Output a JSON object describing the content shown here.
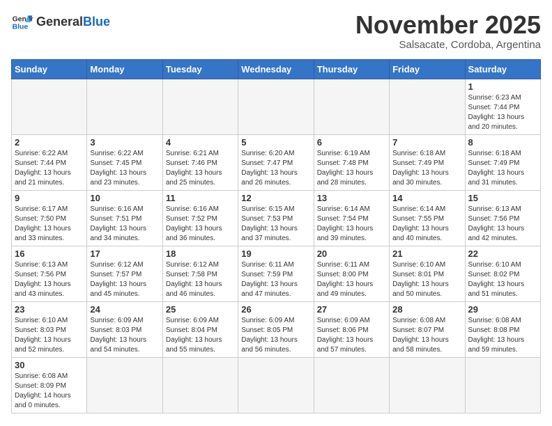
{
  "header": {
    "logo_general": "General",
    "logo_blue": "Blue",
    "month_title": "November 2025",
    "subtitle": "Salsacate, Cordoba, Argentina"
  },
  "weekdays": [
    "Sunday",
    "Monday",
    "Tuesday",
    "Wednesday",
    "Thursday",
    "Friday",
    "Saturday"
  ],
  "weeks": [
    [
      {
        "day": "",
        "info": ""
      },
      {
        "day": "",
        "info": ""
      },
      {
        "day": "",
        "info": ""
      },
      {
        "day": "",
        "info": ""
      },
      {
        "day": "",
        "info": ""
      },
      {
        "day": "",
        "info": ""
      },
      {
        "day": "1",
        "info": "Sunrise: 6:23 AM\nSunset: 7:44 PM\nDaylight: 13 hours and 20 minutes."
      }
    ],
    [
      {
        "day": "2",
        "info": "Sunrise: 6:22 AM\nSunset: 7:44 PM\nDaylight: 13 hours and 21 minutes."
      },
      {
        "day": "3",
        "info": "Sunrise: 6:22 AM\nSunset: 7:45 PM\nDaylight: 13 hours and 23 minutes."
      },
      {
        "day": "4",
        "info": "Sunrise: 6:21 AM\nSunset: 7:46 PM\nDaylight: 13 hours and 25 minutes."
      },
      {
        "day": "5",
        "info": "Sunrise: 6:20 AM\nSunset: 7:47 PM\nDaylight: 13 hours and 26 minutes."
      },
      {
        "day": "6",
        "info": "Sunrise: 6:19 AM\nSunset: 7:48 PM\nDaylight: 13 hours and 28 minutes."
      },
      {
        "day": "7",
        "info": "Sunrise: 6:18 AM\nSunset: 7:49 PM\nDaylight: 13 hours and 30 minutes."
      },
      {
        "day": "8",
        "info": "Sunrise: 6:18 AM\nSunset: 7:49 PM\nDaylight: 13 hours and 31 minutes."
      }
    ],
    [
      {
        "day": "9",
        "info": "Sunrise: 6:17 AM\nSunset: 7:50 PM\nDaylight: 13 hours and 33 minutes."
      },
      {
        "day": "10",
        "info": "Sunrise: 6:16 AM\nSunset: 7:51 PM\nDaylight: 13 hours and 34 minutes."
      },
      {
        "day": "11",
        "info": "Sunrise: 6:16 AM\nSunset: 7:52 PM\nDaylight: 13 hours and 36 minutes."
      },
      {
        "day": "12",
        "info": "Sunrise: 6:15 AM\nSunset: 7:53 PM\nDaylight: 13 hours and 37 minutes."
      },
      {
        "day": "13",
        "info": "Sunrise: 6:14 AM\nSunset: 7:54 PM\nDaylight: 13 hours and 39 minutes."
      },
      {
        "day": "14",
        "info": "Sunrise: 6:14 AM\nSunset: 7:55 PM\nDaylight: 13 hours and 40 minutes."
      },
      {
        "day": "15",
        "info": "Sunrise: 6:13 AM\nSunset: 7:56 PM\nDaylight: 13 hours and 42 minutes."
      }
    ],
    [
      {
        "day": "16",
        "info": "Sunrise: 6:13 AM\nSunset: 7:56 PM\nDaylight: 13 hours and 43 minutes."
      },
      {
        "day": "17",
        "info": "Sunrise: 6:12 AM\nSunset: 7:57 PM\nDaylight: 13 hours and 45 minutes."
      },
      {
        "day": "18",
        "info": "Sunrise: 6:12 AM\nSunset: 7:58 PM\nDaylight: 13 hours and 46 minutes."
      },
      {
        "day": "19",
        "info": "Sunrise: 6:11 AM\nSunset: 7:59 PM\nDaylight: 13 hours and 47 minutes."
      },
      {
        "day": "20",
        "info": "Sunrise: 6:11 AM\nSunset: 8:00 PM\nDaylight: 13 hours and 49 minutes."
      },
      {
        "day": "21",
        "info": "Sunrise: 6:10 AM\nSunset: 8:01 PM\nDaylight: 13 hours and 50 minutes."
      },
      {
        "day": "22",
        "info": "Sunrise: 6:10 AM\nSunset: 8:02 PM\nDaylight: 13 hours and 51 minutes."
      }
    ],
    [
      {
        "day": "23",
        "info": "Sunrise: 6:10 AM\nSunset: 8:03 PM\nDaylight: 13 hours and 52 minutes."
      },
      {
        "day": "24",
        "info": "Sunrise: 6:09 AM\nSunset: 8:03 PM\nDaylight: 13 hours and 54 minutes."
      },
      {
        "day": "25",
        "info": "Sunrise: 6:09 AM\nSunset: 8:04 PM\nDaylight: 13 hours and 55 minutes."
      },
      {
        "day": "26",
        "info": "Sunrise: 6:09 AM\nSunset: 8:05 PM\nDaylight: 13 hours and 56 minutes."
      },
      {
        "day": "27",
        "info": "Sunrise: 6:09 AM\nSunset: 8:06 PM\nDaylight: 13 hours and 57 minutes."
      },
      {
        "day": "28",
        "info": "Sunrise: 6:08 AM\nSunset: 8:07 PM\nDaylight: 13 hours and 58 minutes."
      },
      {
        "day": "29",
        "info": "Sunrise: 6:08 AM\nSunset: 8:08 PM\nDaylight: 13 hours and 59 minutes."
      }
    ],
    [
      {
        "day": "30",
        "info": "Sunrise: 6:08 AM\nSunset: 8:09 PM\nDaylight: 14 hours and 0 minutes."
      },
      {
        "day": "",
        "info": ""
      },
      {
        "day": "",
        "info": ""
      },
      {
        "day": "",
        "info": ""
      },
      {
        "day": "",
        "info": ""
      },
      {
        "day": "",
        "info": ""
      },
      {
        "day": "",
        "info": ""
      }
    ]
  ],
  "colors": {
    "header_bg": "#3575c8",
    "border": "#cccccc"
  }
}
